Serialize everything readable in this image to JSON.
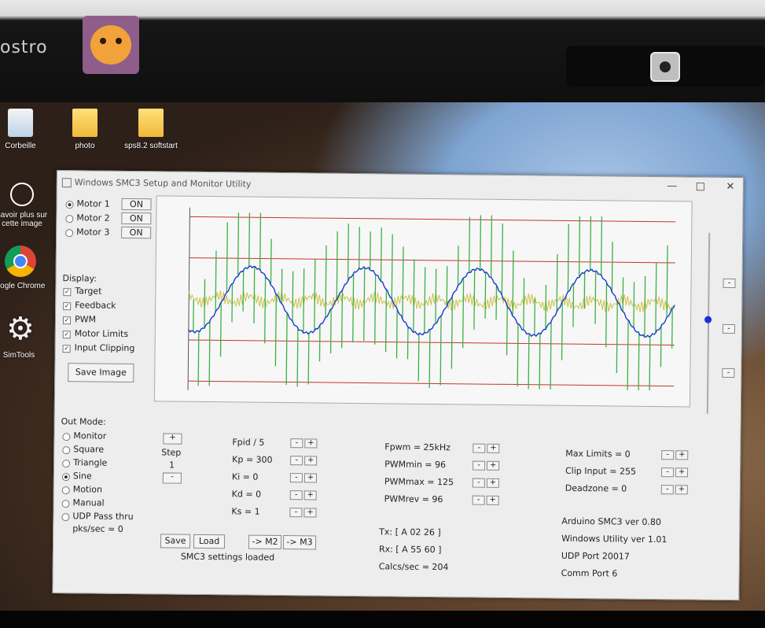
{
  "laptop": {
    "brand": "ostro"
  },
  "desktop": {
    "icons": [
      {
        "label": "Corbeille",
        "icon": "recycle-bin-icon"
      },
      {
        "label": "photo",
        "icon": "folder-icon"
      },
      {
        "label": "sps8.2 softstart",
        "icon": "folder-icon"
      },
      {
        "label": "savoir plus sur cette image",
        "icon": "learn-more-icon"
      },
      {
        "label": "oogle Chrome",
        "icon": "chrome-icon"
      },
      {
        "label": "SimTools",
        "icon": "gear-icon"
      }
    ]
  },
  "window": {
    "title": "Windows SMC3 Setup and Monitor Utility",
    "close": "✕",
    "minimize": "—",
    "maximize": "□",
    "motors": [
      {
        "label": "Motor 1",
        "state": "ON",
        "selected": true
      },
      {
        "label": "Motor 2",
        "state": "ON",
        "selected": false
      },
      {
        "label": "Motor 3",
        "state": "ON",
        "selected": false
      }
    ],
    "display": {
      "heading": "Display:",
      "items": [
        "Target",
        "Feedback",
        "PWM",
        "Motor Limits",
        "Input Clipping"
      ]
    },
    "save_image": "Save Image",
    "out_mode": {
      "heading": "Out Mode:",
      "items": [
        "Monitor",
        "Square",
        "Triangle",
        "Sine",
        "Motion",
        "Manual",
        "UDP Pass thru"
      ],
      "selected": "Sine",
      "pks": "pks/sec = 0"
    },
    "step": {
      "label": "Step",
      "value": "1",
      "plus": "+",
      "minus": "-"
    },
    "pid": [
      "Fpid / 5",
      "Kp = 300",
      "Ki = 0",
      "Kd = 0",
      "Ks = 1"
    ],
    "pwm": [
      "Fpwm = 25kHz",
      "PWMmin = 96",
      "PWMmax = 125",
      "PWMrev = 96"
    ],
    "limits": [
      "Max Limits = 0",
      "Clip Input = 255",
      "Deadzone = 0"
    ],
    "spin": {
      "minus": "-",
      "plus": "+"
    },
    "buttons": {
      "save": "Save",
      "load": "Load",
      "m2": "-> M2",
      "m3": "-> M3"
    },
    "status": "SMC3 settings loaded",
    "comm": {
      "tx": "Tx: [ A 02 26 ]",
      "rx": "Rx: [ A 55 60 ]",
      "calcs": "Calcs/sec = 204"
    },
    "info": [
      "Arduino SMC3 ver 0.80",
      "Windows Utility ver 1.01",
      "UDP Port 20017",
      "Comm Port 6"
    ],
    "slider_buttons": [
      "-",
      "-",
      "-"
    ]
  },
  "chart_data": {
    "type": "line",
    "title": "",
    "xlabel": "",
    "ylabel": "",
    "series": [
      {
        "color": "#1540c8",
        "cycles": 4.3,
        "amplitude": 0.36,
        "offset": 0.0
      },
      {
        "color": "#3cb043",
        "style": "pwm-spikes"
      },
      {
        "color": "#c9c24a",
        "style": "noise-band"
      }
    ],
    "limit_lines": {
      "color": "#c0392b",
      "levels": [
        0.9,
        0.45,
        -0.45,
        -0.9
      ]
    },
    "grid": false
  }
}
